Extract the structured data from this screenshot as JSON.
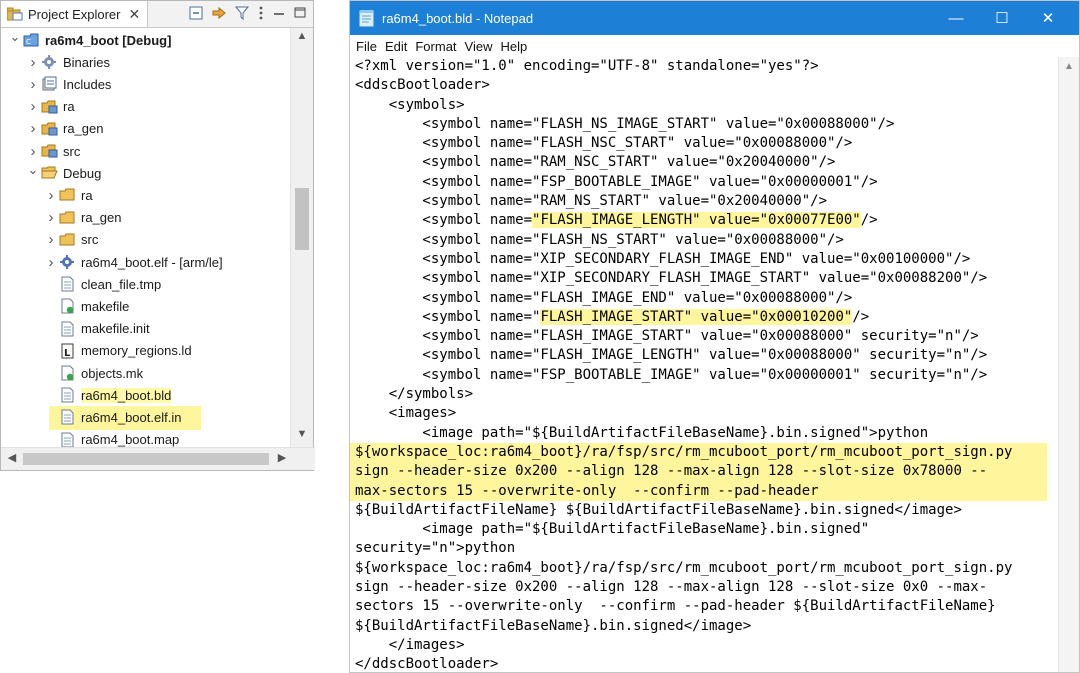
{
  "explorer": {
    "tab_label": "Project Explorer",
    "tab_close": "✕",
    "toolbar_icons": [
      "collapse-all-icon",
      "link-with-editor-icon",
      "filter-icon",
      "view-menu-icon",
      "minimize-icon",
      "maximize-icon"
    ],
    "tree": [
      {
        "label": "ra6m4_boot [Debug]",
        "level": 0,
        "arrow": "⌄",
        "icon": "project-icon",
        "bold": true
      },
      {
        "label": "Binaries",
        "level": 1,
        "arrow": "›",
        "icon": "binaries-icon"
      },
      {
        "label": "Includes",
        "level": 1,
        "arrow": "›",
        "icon": "includes-icon"
      },
      {
        "label": "ra",
        "level": 1,
        "arrow": "›",
        "icon": "source-folder-icon"
      },
      {
        "label": "ra_gen",
        "level": 1,
        "arrow": "›",
        "icon": "source-folder-icon"
      },
      {
        "label": "src",
        "level": 1,
        "arrow": "›",
        "icon": "source-folder-icon"
      },
      {
        "label": "Debug",
        "level": 1,
        "arrow": "⌄",
        "icon": "folder-open-icon"
      },
      {
        "label": "ra",
        "level": 2,
        "arrow": "›",
        "icon": "folder-icon"
      },
      {
        "label": "ra_gen",
        "level": 2,
        "arrow": "›",
        "icon": "folder-icon"
      },
      {
        "label": "src",
        "level": 2,
        "arrow": "›",
        "icon": "folder-icon"
      },
      {
        "label": "ra6m4_boot.elf - [arm/le]",
        "level": 2,
        "arrow": "›",
        "icon": "elf-binary-icon"
      },
      {
        "label": "clean_file.tmp",
        "level": 2,
        "arrow": "",
        "icon": "file-icon"
      },
      {
        "label": "makefile",
        "level": 2,
        "arrow": "",
        "icon": "makefile-icon"
      },
      {
        "label": "makefile.init",
        "level": 2,
        "arrow": "",
        "icon": "file-icon"
      },
      {
        "label": "memory_regions.ld",
        "level": 2,
        "arrow": "",
        "icon": "linker-script-icon"
      },
      {
        "label": "objects.mk",
        "level": 2,
        "arrow": "",
        "icon": "makefile-icon"
      },
      {
        "label": "ra6m4_boot.bld",
        "level": 2,
        "arrow": "",
        "icon": "file-icon",
        "selected": true
      },
      {
        "label": "ra6m4_boot.elf.in",
        "level": 2,
        "arrow": "",
        "icon": "file-icon"
      },
      {
        "label": "ra6m4_boot.map",
        "level": 2,
        "arrow": "",
        "icon": "file-icon"
      }
    ]
  },
  "notepad": {
    "title": "ra6m4_boot.bld - Notepad",
    "window_buttons": {
      "minimize": "—",
      "maximize": "☐",
      "close": "✕"
    },
    "menu": [
      "File",
      "Edit",
      "Format",
      "View",
      "Help"
    ],
    "lines": [
      {
        "t": "<?xml version=\"1.0\" encoding=\"UTF-8\" standalone=\"yes\"?>"
      },
      {
        "t": "<ddscBootloader>"
      },
      {
        "t": "    <symbols>"
      },
      {
        "t": "        <symbol name=\"FLASH_NS_IMAGE_START\" value=\"0x00088000\"/>"
      },
      {
        "t": "        <symbol name=\"FLASH_NSC_START\" value=\"0x00088000\"/>"
      },
      {
        "t": "        <symbol name=\"RAM_NSC_START\" value=\"0x20040000\"/>"
      },
      {
        "t": "        <symbol name=\"FSP_BOOTABLE_IMAGE\" value=\"0x00000001\"/>"
      },
      {
        "t": "        <symbol name=\"RAM_NS_START\" value=\"0x20040000\"/>"
      },
      {
        "pre": "        <symbol name=",
        "hl": "\"FLASH_IMAGE_LENGTH\" value=\"0x00077E00\"",
        "post": "/>"
      },
      {
        "t": "        <symbol name=\"FLASH_NS_START\" value=\"0x00088000\"/>"
      },
      {
        "t": "        <symbol name=\"XIP_SECONDARY_FLASH_IMAGE_END\" value=\"0x00100000\"/>"
      },
      {
        "t": "        <symbol name=\"XIP_SECONDARY_FLASH_IMAGE_START\" value=\"0x00088200\"/>"
      },
      {
        "t": "        <symbol name=\"FLASH_IMAGE_END\" value=\"0x00088000\"/>"
      },
      {
        "pre": "        <symbol name=\"",
        "hl": "FLASH_IMAGE_START\" value=\"0x00010200\"",
        "post": "/>"
      },
      {
        "t": "        <symbol name=\"FLASH_IMAGE_START\" value=\"0x00088000\" security=\"n\"/>"
      },
      {
        "t": "        <symbol name=\"FLASH_IMAGE_LENGTH\" value=\"0x00088000\" security=\"n\"/>"
      },
      {
        "t": "        <symbol name=\"FSP_BOOTABLE_IMAGE\" value=\"0x00000001\" security=\"n\"/>"
      },
      {
        "t": "    </symbols>"
      },
      {
        "t": "    <images>"
      },
      {
        "t": "        <image path=\"${BuildArtifactFileBaseName}.bin.signed\">python"
      },
      {
        "block": "${workspace_loc:ra6m4_boot}/ra/fsp/src/rm_mcuboot_port/rm_mcuboot_port_sign.py"
      },
      {
        "block": "sign --header-size 0x200 --align 128 --max-align 128 --slot-size 0x78000 --"
      },
      {
        "block": "max-sectors 15 --overwrite-only  --confirm --pad-header"
      },
      {
        "t": "${BuildArtifactFileName} ${BuildArtifactFileBaseName}.bin.signed</image>"
      },
      {
        "t": "        <image path=\"${BuildArtifactFileBaseName}.bin.signed\""
      },
      {
        "t": "security=\"n\">python"
      },
      {
        "t": "${workspace_loc:ra6m4_boot}/ra/fsp/src/rm_mcuboot_port/rm_mcuboot_port_sign.py"
      },
      {
        "t": "sign --header-size 0x200 --align 128 --max-align 128 --slot-size 0x0 --max-"
      },
      {
        "t": "sectors 15 --overwrite-only  --confirm --pad-header ${BuildArtifactFileName}"
      },
      {
        "t": "${BuildArtifactFileBaseName}.bin.signed</image>"
      },
      {
        "t": "    </images>"
      },
      {
        "t": "</ddscBootloader>"
      }
    ]
  },
  "colors": {
    "titlebar": "#1e7fd6",
    "highlight": "#fff59d"
  }
}
